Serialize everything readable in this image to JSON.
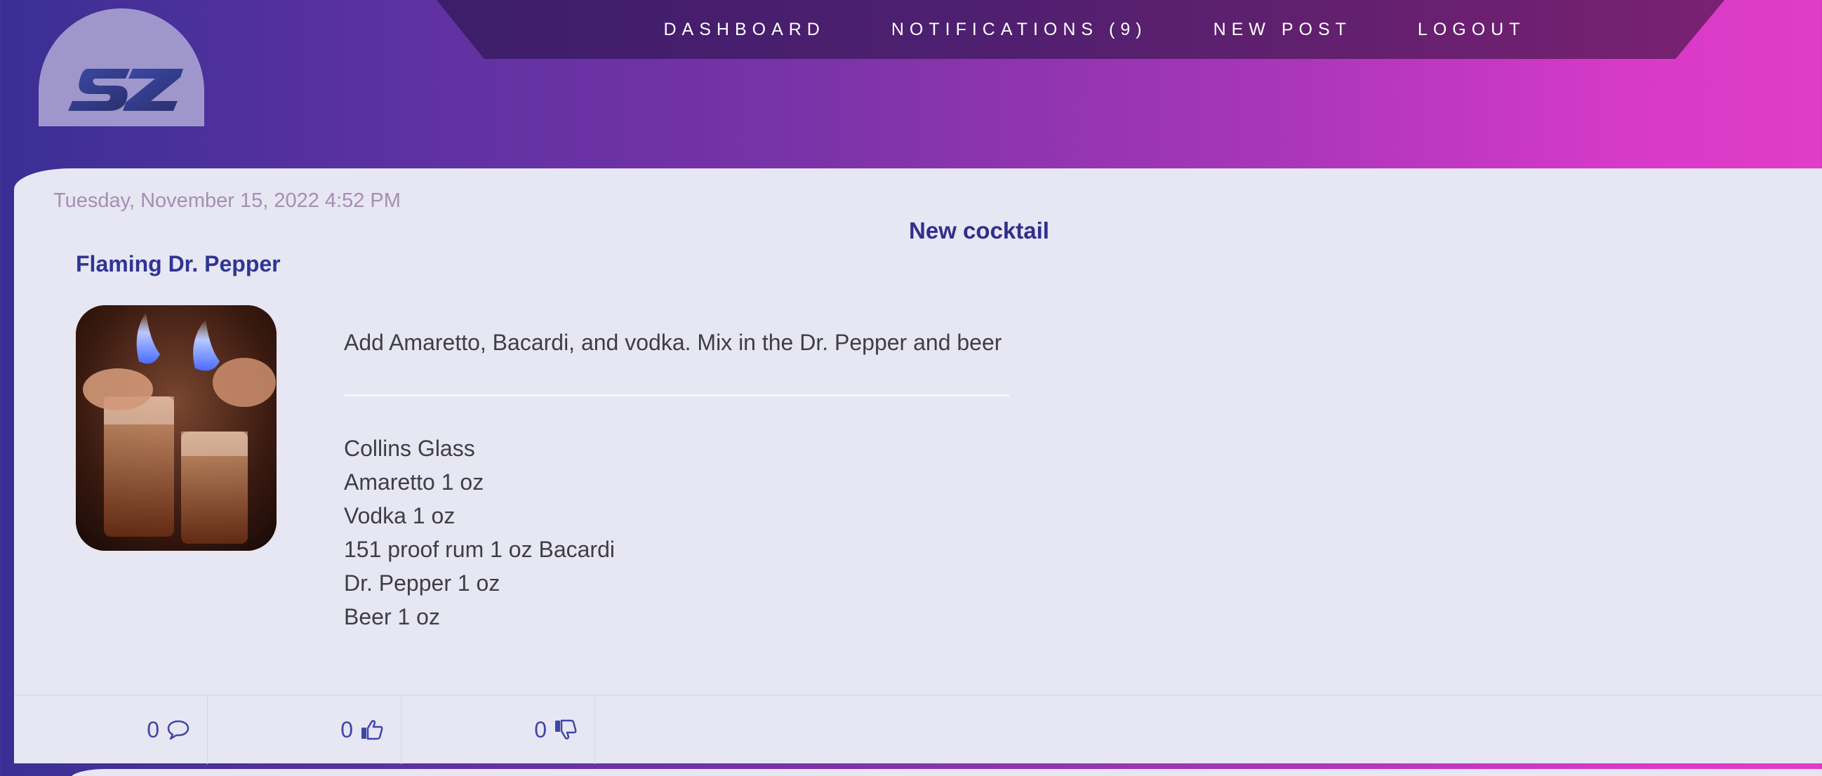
{
  "nav": {
    "items": [
      {
        "label": "DASHBOARD"
      },
      {
        "label": "NOTIFICATIONS (9)"
      },
      {
        "label": "NEW POST"
      },
      {
        "label": "LOGOUT"
      }
    ]
  },
  "logo": {
    "text": "SZ"
  },
  "post": {
    "date": "Tuesday, November 15, 2022 4:52 PM",
    "type": "New cocktail",
    "title": "Flaming Dr. Pepper",
    "image_alt": "flaming-drinks-photo",
    "description": "Add Amaretto, Bacardi, and vodka. Mix in the Dr. Pepper and beer",
    "ingredients": [
      "Collins Glass",
      "Amaretto 1 oz",
      "Vodka 1 oz",
      "151 proof rum 1 oz Bacardi",
      "Dr. Pepper 1 oz",
      "Beer 1 oz"
    ],
    "actions": {
      "comments": "0",
      "likes": "0",
      "dislikes": "0"
    }
  },
  "colors": {
    "accent": "#2f3592",
    "card": "#e7e6f3",
    "gradient_start": "#3a2f94",
    "gradient_end": "#e03cc8"
  }
}
